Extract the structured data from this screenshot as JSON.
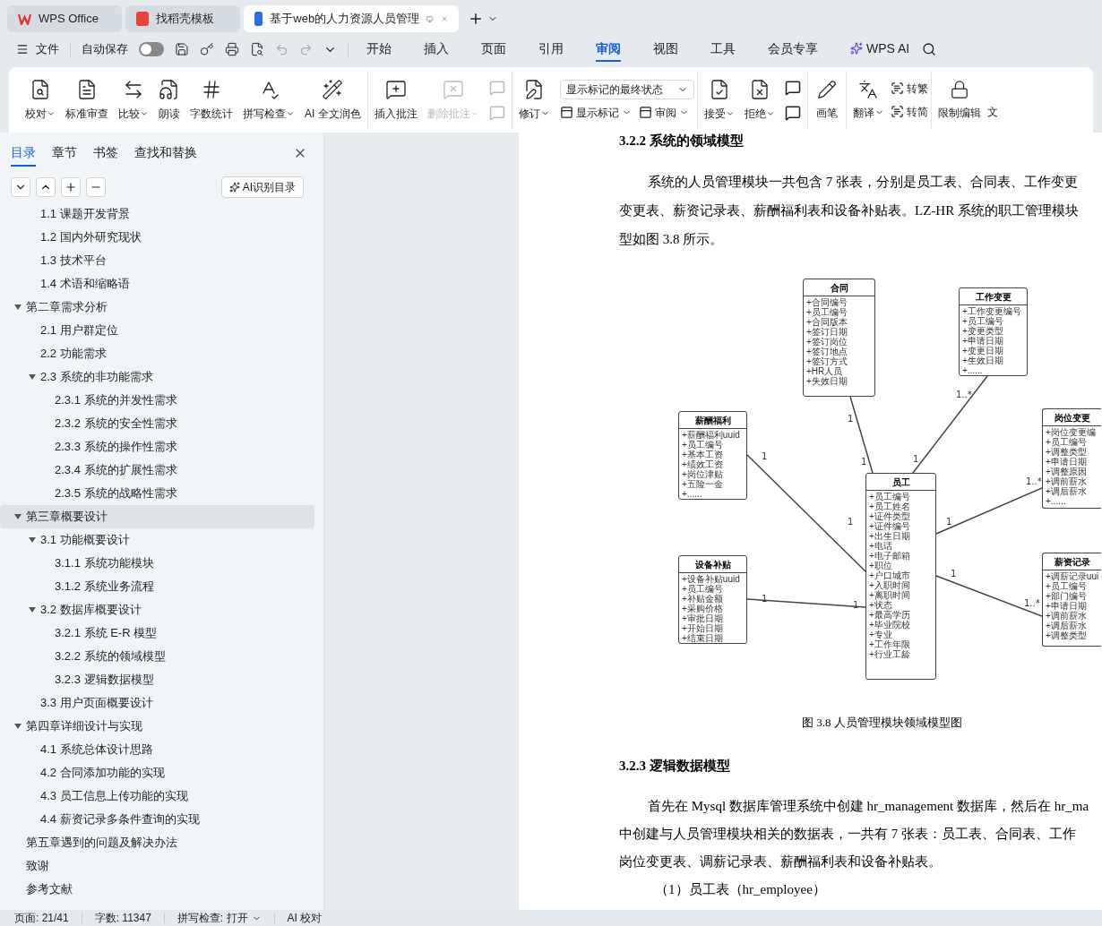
{
  "title_tabs": [
    {
      "label": "WPS Office",
      "selected": false
    },
    {
      "label": "找稻壳模板",
      "selected": false
    },
    {
      "label": "基于web的人力资源人员管理",
      "selected": true
    }
  ],
  "quick_bar": {
    "file_menu": "文件",
    "autosave_label": "自动保存",
    "autosave_on": false
  },
  "menu_tabs": [
    {
      "label": "开始",
      "selected": false
    },
    {
      "label": "插入",
      "selected": false
    },
    {
      "label": "页面",
      "selected": false
    },
    {
      "label": "引用",
      "selected": false
    },
    {
      "label": "审阅",
      "selected": true
    },
    {
      "label": "视图",
      "selected": false
    },
    {
      "label": "工具",
      "selected": false
    },
    {
      "label": "会员专享",
      "selected": false
    },
    {
      "label": "WPS AI",
      "selected": false
    }
  ],
  "ribbon": {
    "proof_group": [
      {
        "label": "校对",
        "menu": true,
        "disabled": false
      },
      {
        "label": "标准审查",
        "menu": false,
        "disabled": false
      },
      {
        "label": "比较",
        "menu": true,
        "disabled": false
      },
      {
        "label": "朗读",
        "menu": false,
        "disabled": false
      },
      {
        "label": "字数统计",
        "menu": false,
        "disabled": false
      },
      {
        "label": "拼写检查",
        "menu": true,
        "disabled": false
      },
      {
        "label": "AI 全文润色",
        "menu": false,
        "disabled": false
      }
    ],
    "comment_group": [
      {
        "label": "插入批注",
        "menu": false,
        "disabled": false
      },
      {
        "label": "删除批注",
        "menu": true,
        "disabled": true
      }
    ],
    "revision": {
      "label": "修订",
      "markup_select": "显示标记的最终状态",
      "show_markup": "显示标记",
      "review_pane": "审阅"
    },
    "accept_group": [
      {
        "label": "接受",
        "menu": true,
        "disabled": false
      },
      {
        "label": "拒绝",
        "menu": true,
        "disabled": false
      }
    ],
    "pen": "画笔",
    "translate": {
      "label": "翻译",
      "to_traditional": "转繁",
      "to_simplified": "转简"
    },
    "restrict": "限制编辑",
    "cut_item": "文"
  },
  "sidebar": {
    "tabs": [
      {
        "label": "目录",
        "selected": true
      },
      {
        "label": "章节",
        "selected": false
      },
      {
        "label": "书签",
        "selected": false
      },
      {
        "label": "查找和替换",
        "selected": false
      }
    ],
    "ai_button": "AI识别目录",
    "partial_items": [
      {
        "label": "1.1 课题开发背景"
      },
      {
        "label": "1.2 国内外研究现状"
      },
      {
        "label": "1.3 技术平台"
      },
      {
        "label": "1.4 术语和缩略语"
      }
    ],
    "toc": [
      {
        "label": "第二章需求分析",
        "selected": false,
        "expanded": true,
        "children": [
          {
            "label": "2.1 用户群定位",
            "selected": false
          },
          {
            "label": "2.2 功能需求",
            "selected": false
          },
          {
            "label": "2.3 系统的非功能需求",
            "selected": false,
            "expanded": true,
            "children": [
              {
                "label": "2.3.1 系统的并发性需求",
                "selected": false
              },
              {
                "label": "2.3.2 系统的安全性需求",
                "selected": false
              },
              {
                "label": "2.3.3 系统的操作性需求",
                "selected": false
              },
              {
                "label": "2.3.4 系统的扩展性需求",
                "selected": false
              },
              {
                "label": "2.3.5 系统的战略性需求",
                "selected": false
              }
            ]
          }
        ]
      },
      {
        "label": "第三章概要设计",
        "selected": true,
        "expanded": true,
        "children": [
          {
            "label": "3.1 功能概要设计",
            "selected": false,
            "expanded": true,
            "children": [
              {
                "label": "3.1.1 系统功能模块",
                "selected": false
              },
              {
                "label": "3.1.2 系统业务流程",
                "selected": false
              }
            ]
          },
          {
            "label": "3.2 数据库概要设计",
            "selected": false,
            "expanded": true,
            "children": [
              {
                "label": "3.2.1 系统 E-R 模型",
                "selected": false
              },
              {
                "label": "3.2.2 系统的领域模型",
                "selected": false
              },
              {
                "label": "3.2.3 逻辑数据模型",
                "selected": false
              }
            ]
          },
          {
            "label": "3.3 用户页面概要设计",
            "selected": false
          }
        ]
      },
      {
        "label": "第四章详细设计与实现",
        "selected": false,
        "expanded": true,
        "children": [
          {
            "label": "4.1 系统总体设计思路",
            "selected": false
          },
          {
            "label": "4.2 合同添加功能的实现",
            "selected": false
          },
          {
            "label": "4.3 员工信息上传功能的实现",
            "selected": false
          },
          {
            "label": "4.4 薪资记录多条件查询的实现",
            "selected": false
          }
        ]
      },
      {
        "label": "第五章遇到的问题及解决办法",
        "selected": false
      },
      {
        "label": "致谢",
        "selected": false
      },
      {
        "label": "参考文献",
        "selected": false
      }
    ]
  },
  "document": {
    "heading_1": "3.2.2 系统的领域模型",
    "paragraph_1": [
      "系统的人员管理模块一共包含 7 张表，分别是员工表、合同表、工作变更",
      "变更表、薪资记录表、薪酬福利表和设备补贴表。LZ-HR 系统的职工管理模块",
      "型如图 3.8 所示。"
    ],
    "diagram": {
      "classes": [
        {
          "name": "合同",
          "attributes": [
            "+合同编号",
            "+员工编号",
            "+合同版本",
            "+签订日期",
            "+签订岗位",
            "+签订地点",
            "+签订方式",
            "+HR人员",
            "+失效日期"
          ]
        },
        {
          "name": "工作变更",
          "attributes": [
            "+工作变更编号",
            "+员工编号",
            "+变更类型",
            "+申请日期",
            "+变更日期",
            "+生效日期",
            "+......"
          ]
        },
        {
          "name": "薪酬福利",
          "attributes": [
            "+薪酬福利uuid",
            "+员工编号",
            "+基本工资",
            "+绩效工资",
            "+岗位津贴",
            "+五险一金",
            "+......"
          ]
        },
        {
          "name": "岗位变更",
          "attributes": [
            "+岗位变更编",
            "+员工编号",
            "+调整类型",
            "+申请日期",
            "+调整原因",
            "+调前薪水",
            "+调后薪水",
            "+......"
          ]
        },
        {
          "name": "员工",
          "attributes": [
            "+员工编号",
            "+员工姓名",
            "+证件类型",
            "+证件编号",
            "+出生日期",
            "+电话",
            "+电子邮箱",
            "+职位",
            "+户口城市",
            "+入职时间",
            "+离职时间",
            "+状态",
            "+最高学历",
            "+毕业院校",
            "+专业",
            "+工作年限",
            "+行业工龄"
          ]
        },
        {
          "name": "设备补贴",
          "attributes": [
            "+设备补贴uuid",
            "+员工编号",
            "+补贴金额",
            "+采购价格",
            "+审批日期",
            "+开始日期",
            "+结束日期"
          ]
        },
        {
          "name": "薪资记录",
          "attributes": [
            "+调薪记录uui",
            "+员工编号",
            "+部门编号",
            "+申请日期",
            "+调前薪水",
            "+调后薪水",
            "+调整类型"
          ]
        }
      ],
      "associations": [
        {
          "end_a": "1",
          "end_b": "1"
        },
        {
          "end_a": "1..*",
          "end_b": "1"
        },
        {
          "end_a": "1",
          "end_b": "1"
        },
        {
          "end_a": "1..*",
          "end_b": "1"
        },
        {
          "end_a": "1",
          "end_b": "1"
        },
        {
          "end_a": "1..*",
          "end_b": "1"
        }
      ]
    },
    "caption": "图 3.8  人员管理模块领域模型图",
    "heading_2": "3.2.3 逻辑数据模型",
    "paragraph_2": [
      "首先在 Mysql 数据库管理系统中创建 hr_management 数据库，然后在 hr_ma",
      "中创建与人员管理模块相关的数据表，一共有 7 张表：员工表、合同表、工作",
      "岗位变更表、调薪记录表、薪酬福利表和设备补贴表。"
    ],
    "list_item": "（1）员工表（hr_employee）"
  },
  "status_bar": {
    "page": "页面: 21/41",
    "words": "字数: 11347",
    "spell": "拼写检查: 打开",
    "ai_check": "AI 校对"
  }
}
